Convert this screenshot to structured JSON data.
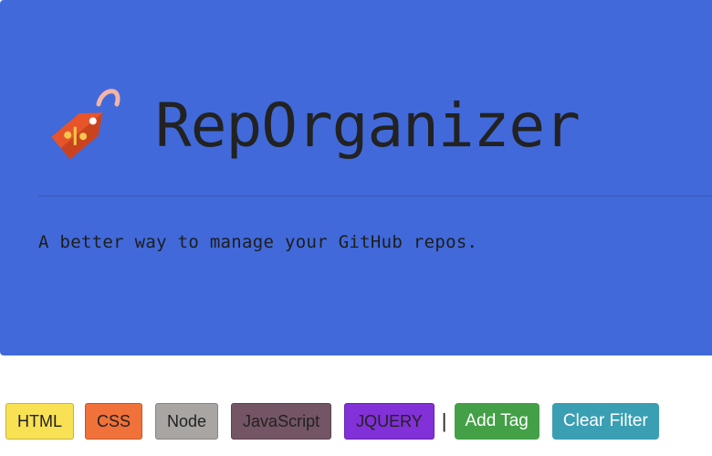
{
  "header": {
    "logo_icon": "price-tag-icon",
    "title": "RepOrganizer",
    "tagline": "A better way to manage your GitHub repos."
  },
  "tags": [
    {
      "label": "HTML",
      "color": "#f9e154",
      "text_color": "#222222"
    },
    {
      "label": "CSS",
      "color": "#f07139",
      "text_color": "#222222"
    },
    {
      "label": "Node",
      "color": "#a9a5a3",
      "text_color": "#222222"
    },
    {
      "label": "JavaScript",
      "color": "#745565",
      "text_color": "#222222"
    },
    {
      "label": "JQUERY",
      "color": "#8230d7",
      "text_color": "#222222"
    }
  ],
  "separator": "|",
  "actions": {
    "add_tag_label": "Add Tag",
    "add_tag_color": "#43a046",
    "clear_filter_label": "Clear Filter",
    "clear_filter_color": "#3a9fb3"
  },
  "colors": {
    "hero_background": "#4169d9"
  }
}
